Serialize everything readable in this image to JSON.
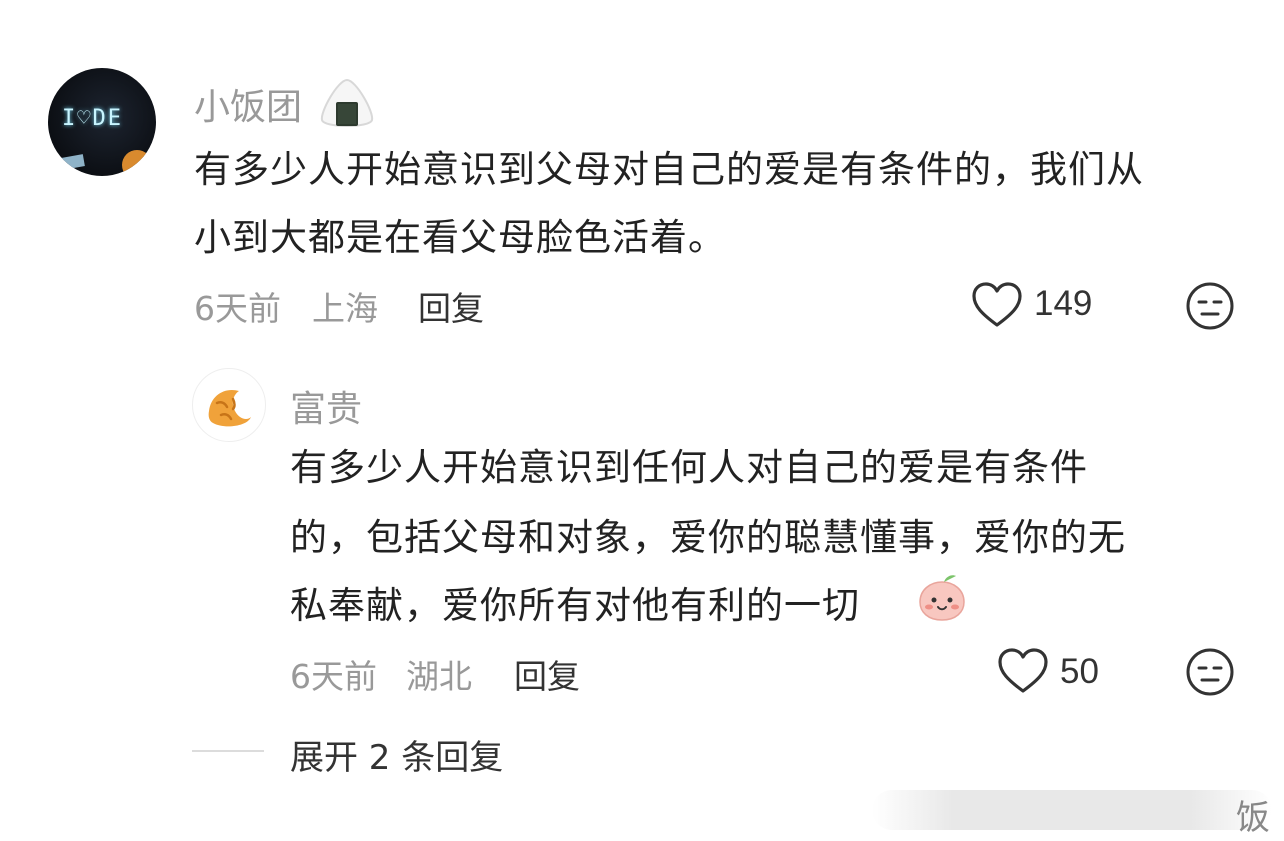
{
  "main_comment": {
    "username": "小饭团",
    "avatar_text": "I♡DE",
    "text_line1": "有多少人开始意识到父母对自己的爱是有条件的，我们从",
    "text_line2": "小到大都是在看父母脸色活着。",
    "time": "6天前",
    "location": "上海",
    "reply_label": "回复",
    "likes": "149",
    "icons": {
      "badge": "onigiri-icon",
      "like": "heart-icon",
      "dislike": "meh-face-icon"
    }
  },
  "reply_comment": {
    "username": "富贵",
    "text_line1": "有多少人开始意识到任何人对自己的爱是有条件",
    "text_line2": "的，包括父母和对象，爱你的聪慧懂事，爱你的无",
    "text_line3": "私奉献，爱你所有对他有利的一切",
    "time": "6天前",
    "location": "湖北",
    "reply_label": "回复",
    "likes": "50",
    "icons": {
      "avatar": "croissant-icon",
      "emoji": "peach-face-icon",
      "like": "heart-icon",
      "dislike": "meh-face-icon"
    }
  },
  "expand_replies": "展开 2 条回复",
  "watermark": "饭"
}
